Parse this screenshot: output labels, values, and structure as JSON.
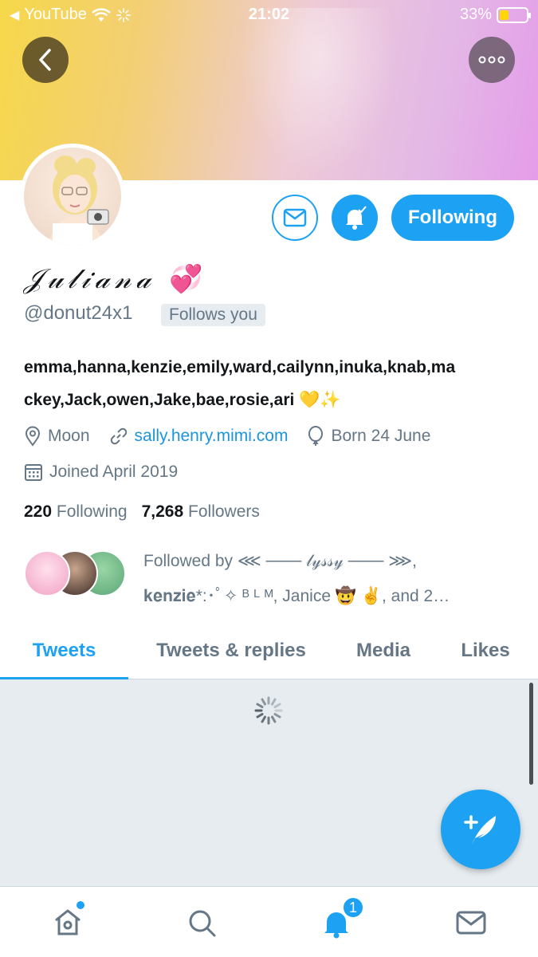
{
  "status_bar": {
    "back_app": "YouTube",
    "time": "21:02",
    "battery": "33%",
    "battery_level": 0.33
  },
  "header": {
    "back_label": "Back",
    "more_label": "More"
  },
  "profile": {
    "name": "𝒥𝓊𝓁𝒾𝒶𝓃𝒶",
    "name_emoji": "💞",
    "handle": "@donut24x1",
    "follows_you": "Follows you",
    "follow_button": "Following",
    "bio_line1": "emma,hanna,kenzie,emily,ward,cailynn,inuka,knab,ma",
    "bio_line2": "ckey,Jack,owen,Jake,bae,rosie,ari 💛✨",
    "location": "Moon",
    "website": "sally.henry.mimi.com",
    "birthday": "Born 24 June",
    "joined": "Joined April 2019",
    "following_count": "220",
    "following_label": "Following",
    "followers_count": "7,268",
    "followers_label": "Followers",
    "followed_by_line1": "Followed by ⋘ ─── 𝓁𝓎𝓈𝓈𝓎 ─── ⋙,",
    "followed_by_line2": "𝐤𝐞𝐧𝐳𝐢𝐞*:･ﾟ✧ ᴮ ᴸ ᴹ, Janice 🤠 ✌️, and 2…"
  },
  "tabs": [
    {
      "label": "Tweets",
      "active": true
    },
    {
      "label": "Tweets & replies",
      "active": false
    },
    {
      "label": "Media",
      "active": false
    },
    {
      "label": "Likes",
      "active": false
    }
  ],
  "bottom_nav": {
    "notifications_badge": "1",
    "items": [
      "home-icon",
      "search-icon",
      "notifications-icon",
      "messages-icon"
    ]
  },
  "colors": {
    "accent": "#1da1f2",
    "secondary_text": "#657786",
    "feed_bg": "#e6ecf0"
  }
}
